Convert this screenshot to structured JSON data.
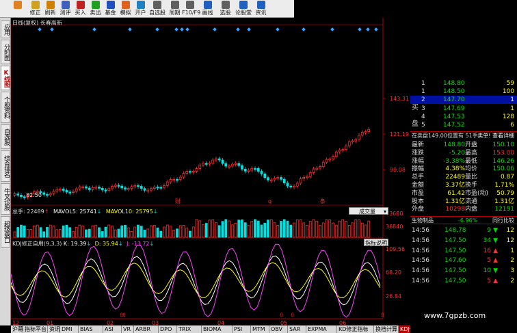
{
  "toolbar": [
    {
      "label": "",
      "icon": "back-icon",
      "color": "#e08020"
    },
    {
      "label": "修正",
      "icon": "down-arrow-icon",
      "color": "#d0a020"
    },
    {
      "label": "刷新",
      "icon": "refresh-icon",
      "color": "#d08000"
    },
    {
      "label": "测评",
      "icon": "clock-icon",
      "color": "#4060c0"
    },
    {
      "label": "买入",
      "icon": "buy-icon",
      "color": "#c02020"
    },
    {
      "label": "卖出",
      "icon": "sell-icon",
      "color": "#20a020"
    },
    {
      "label": "基金",
      "icon": "fund-icon",
      "color": "#2050c0"
    },
    {
      "label": "模拟",
      "icon": "sim-icon",
      "color": "#e06020"
    },
    {
      "label": "开户",
      "icon": "account-icon",
      "color": "#2080c0"
    },
    {
      "label": "自选股",
      "icon": "favorites-icon",
      "color": "#606060"
    },
    {
      "label": "周期",
      "icon": "period-icon",
      "color": "#606060"
    },
    {
      "label": "F10/F9",
      "icon": "f10-icon",
      "color": "#606060"
    },
    {
      "label": "画线",
      "icon": "draw-icon",
      "color": "#2060c0"
    },
    {
      "label": "选股",
      "icon": "stock-pick-icon",
      "color": "#606060"
    },
    {
      "label": "论股堂",
      "icon": "forum-icon",
      "color": "#2060c0"
    },
    {
      "label": "资讯",
      "icon": "news-icon",
      "color": "#2060c0"
    }
  ],
  "left_tabs": [
    "应用",
    "分时图",
    "K线图",
    "个股资料",
    "自选股",
    "综合排名",
    "牛叉诊股",
    "超级盘口"
  ],
  "left_tab_active": 2,
  "main_header": "日线(复权) 长春高新",
  "price_axis": [
    "143.31",
    "121.19",
    "99.08"
  ],
  "low_marker": "82.50",
  "event_markers": [
    "财",
    "q",
    "条"
  ],
  "volume_header": {
    "total": "总手: 22489",
    "mavol5": "MAVOL5: 25741",
    "mavol10": "MAVOL10: 25795",
    "dropdown": "成交量"
  },
  "volume_axis": [
    "73680",
    "36840"
  ],
  "kdj_header": {
    "name": "KDJ修正自用(9,3,3)",
    "k": "K: 19.39",
    "d": "D: 35.94",
    "j": "J: -13.72",
    "button": "指标说明"
  },
  "kdj_axis": [
    "109.56",
    "68.20",
    "26.84"
  ],
  "date_axis": [
    "12",
    "01",
    "02",
    "03",
    "04",
    "05",
    "06"
  ],
  "bottom_tabs": [
    "沪幕",
    "指标平台",
    "资讯",
    "DMI",
    "BIAS",
    "ASI",
    "VR",
    "ARBR",
    "DPO",
    "TRIX",
    "BIOMA",
    "PSI",
    "MTM",
    "OBV",
    "SAR",
    "EXPMA",
    "KD修正指标",
    "换档计算",
    "KDJ修正自用"
  ],
  "bottom_tab_active": 18,
  "order_book": {
    "side_label_buy": "买",
    "side_label_pan": "盘",
    "sell_rows": [
      {
        "level": "1",
        "price": "148.80",
        "vol": "59"
      },
      {
        "level": "1",
        "price": "148.50",
        "vol": "100"
      },
      {
        "level": "2",
        "price": "147.70",
        "vol": "1"
      },
      {
        "level": "3",
        "price": "147.69",
        "vol": "1"
      },
      {
        "level": "4",
        "price": "147.53",
        "vol": "128"
      },
      {
        "level": "5",
        "price": "147.52",
        "vol": "6"
      }
    ],
    "status": "在卖盘149.00位置有 51手",
    "status_link": "卖单! 查看详细"
  },
  "quote": [
    {
      "l1": "最新",
      "v1": "148.80",
      "l2": "开盘",
      "v2": "150.10",
      "c1": "#00e000",
      "c2": "#00e000"
    },
    {
      "l1": "涨跌",
      "v1": "-5.20",
      "l2": "最高",
      "v2": "153.00",
      "c1": "#00e000",
      "c2": "#ff3030"
    },
    {
      "l1": "涨幅",
      "v1": "-3.38%",
      "l2": "最低",
      "v2": "146.26",
      "c1": "#00e000",
      "c2": "#00e000"
    },
    {
      "l1": "振幅",
      "v1": "4.38%",
      "l2": "均价",
      "v2": "150.06",
      "c1": "#ffff00",
      "c2": "#00e000"
    },
    {
      "l1": "总手",
      "v1": "22489",
      "l2": "量比",
      "v2": "0.87",
      "c1": "#ffff00",
      "c2": "#ffff00"
    },
    {
      "l1": "金额",
      "v1": "3.37亿",
      "l2": "换手",
      "v2": "1.71%",
      "c1": "#ffff00",
      "c2": "#ffff00"
    },
    {
      "l1": "市盈",
      "v1": "61.42",
      "l2": "市盈(动)",
      "v2": "50.79",
      "c1": "#ffff00",
      "c2": "#ffff00"
    },
    {
      "l1": "股本",
      "v1": "1.31亿",
      "l2": "流通",
      "v2": "1.31亿",
      "c1": "#ffff00",
      "c2": "#ffff00"
    },
    {
      "l1": "外盘",
      "v1": "10298",
      "l2": "内盘",
      "v2": "12191",
      "c1": "#ff3030",
      "c2": "#00e000"
    }
  ],
  "industry": {
    "name": "生物制品",
    "change": "-6.96%",
    "link": "同行比较"
  },
  "ticks": [
    {
      "time": "14:56",
      "price": "148.78",
      "vol": "9",
      "dir": "down",
      "num": "12",
      "pc": "#00e000"
    },
    {
      "time": "14:56",
      "price": "147.50",
      "vol": "34",
      "dir": "down",
      "num": "12",
      "pc": "#00e000"
    },
    {
      "time": "14:56",
      "price": "147.50",
      "vol": "16",
      "dir": "up",
      "num": "1",
      "pc": "#00e000"
    },
    {
      "time": "14:56",
      "price": "147.60",
      "vol": "5",
      "dir": "up",
      "num": "2",
      "pc": "#00e000"
    },
    {
      "time": "14:56",
      "price": "147.50",
      "vol": "10",
      "dir": "down",
      "num": "3",
      "pc": "#00e000"
    },
    {
      "time": "14:56",
      "price": "147.50",
      "vol": "5",
      "dir": "up",
      "num": "2",
      "pc": "#00e000"
    }
  ],
  "watermark": "www.7gpzb.com",
  "colors": {
    "up": "#ff3030",
    "down": "#00e0e0",
    "ma5": "#ffffff",
    "ma10": "#ffff00",
    "kline_k": "#ffffff",
    "kline_d": "#ffff00",
    "kline_j": "#ff40ff"
  }
}
